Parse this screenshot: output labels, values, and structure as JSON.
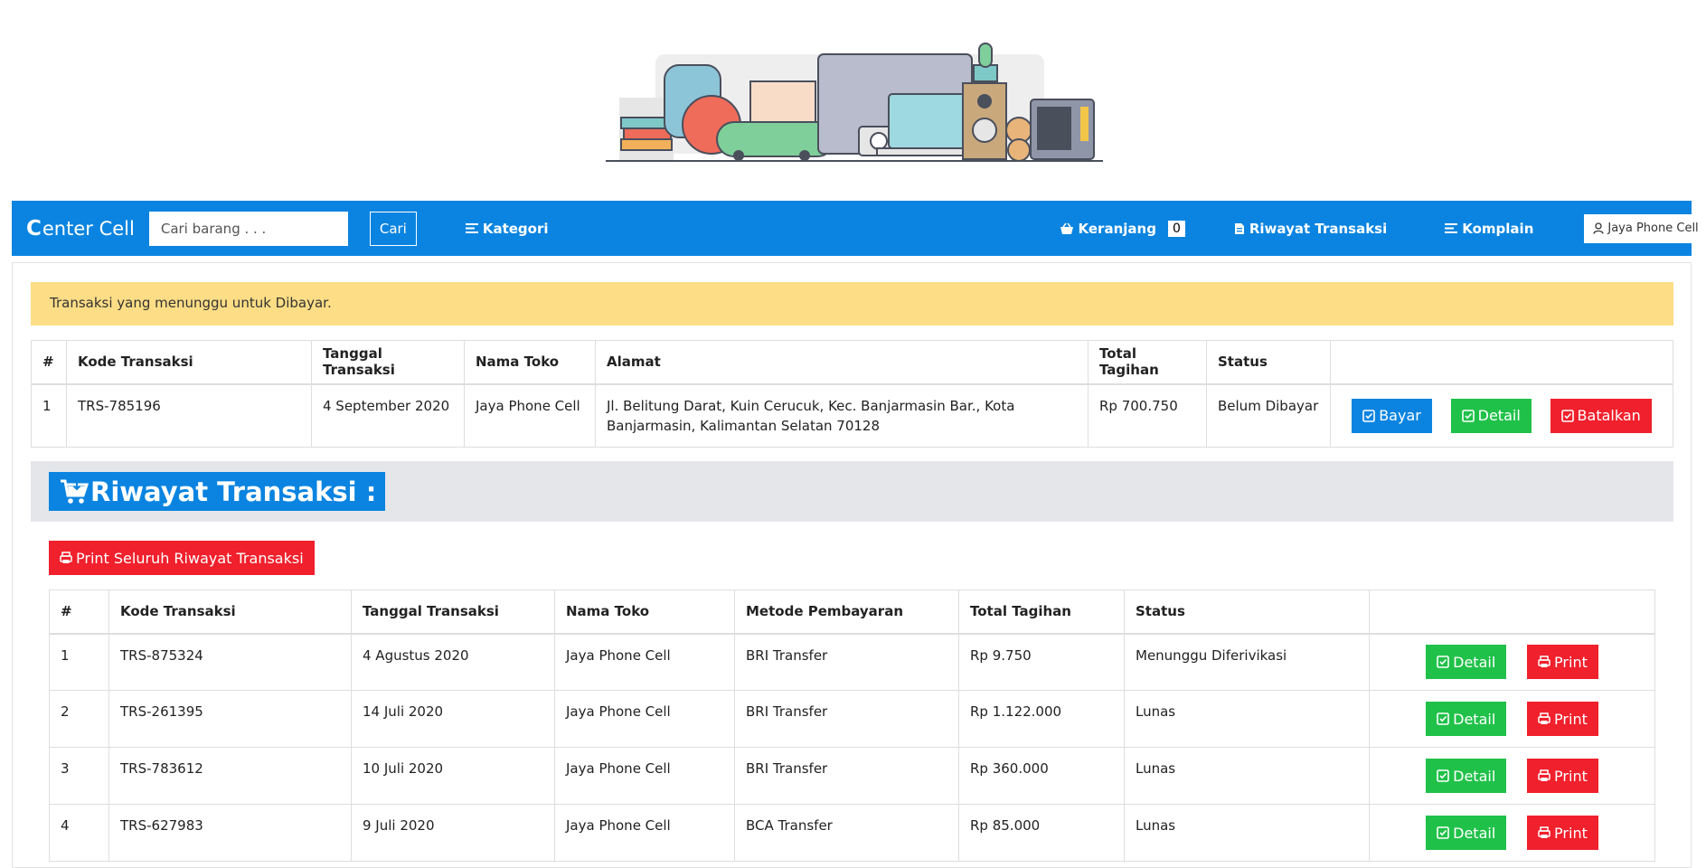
{
  "brand": {
    "logo_letter": "C",
    "rest": "enter Cell"
  },
  "search": {
    "placeholder": "Cari barang . . .",
    "button": "Cari"
  },
  "nav": {
    "kategori": "Kategori",
    "keranjang": "Keranjang",
    "cart_count": "0",
    "riwayat": "Riwayat Transaksi",
    "komplain": "Komplain",
    "user": "Jaya Phone Cell"
  },
  "alert": {
    "text": "Transaksi yang menunggu untuk Dibayar."
  },
  "pending_table": {
    "headers": [
      "#",
      "Kode Transaksi",
      "Tanggal Transaksi",
      "Nama Toko",
      "Alamat",
      "Total Tagihan",
      "Status",
      ""
    ],
    "rows": [
      {
        "no": "1",
        "kode": "TRS-785196",
        "tanggal": "4 September 2020",
        "toko": "Jaya Phone Cell",
        "alamat": "Jl. Belitung Darat, Kuin Cerucuk, Kec. Banjarmasin Bar., Kota Banjarmasin, Kalimantan Selatan 70128",
        "total": "Rp 700.750",
        "status": "Belum Dibayar",
        "btn_bayar": "Bayar",
        "btn_detail": "Detail",
        "btn_batal": "Batalkan"
      }
    ]
  },
  "history": {
    "title": "Riwayat Transaksi :",
    "print_all": "Print Seluruh Riwayat Transaksi",
    "headers": [
      "#",
      "Kode Transaksi",
      "Tanggal Transaksi",
      "Nama Toko",
      "Metode Pembayaran",
      "Total Tagihan",
      "Status",
      ""
    ],
    "rows": [
      {
        "no": "1",
        "kode": "TRS-875324",
        "tanggal": "4 Agustus 2020",
        "toko": "Jaya Phone Cell",
        "metode": "BRI Transfer",
        "total": "Rp 9.750",
        "status": "Menunggu Diferivikasi",
        "btn_detail": "Detail",
        "btn_print": "Print"
      },
      {
        "no": "2",
        "kode": "TRS-261395",
        "tanggal": "14 Juli 2020",
        "toko": "Jaya Phone Cell",
        "metode": "BRI Transfer",
        "total": "Rp 1.122.000",
        "status": "Lunas",
        "btn_detail": "Detail",
        "btn_print": "Print"
      },
      {
        "no": "3",
        "kode": "TRS-783612",
        "tanggal": "10 Juli 2020",
        "toko": "Jaya Phone Cell",
        "metode": "BRI Transfer",
        "total": "Rp 360.000",
        "status": "Lunas",
        "btn_detail": "Detail",
        "btn_print": "Print"
      },
      {
        "no": "4",
        "kode": "TRS-627983",
        "tanggal": "9 Juli 2020",
        "toko": "Jaya Phone Cell",
        "metode": "BCA Transfer",
        "total": "Rp 85.000",
        "status": "Lunas",
        "btn_detail": "Detail",
        "btn_print": "Print"
      }
    ]
  },
  "icons": {
    "cart": "basket-icon",
    "history": "document-icon",
    "menu": "list-icon",
    "user": "user-icon",
    "check": "check-square-icon",
    "print": "printer-icon",
    "cart_title": "shopping-cart-icon"
  },
  "colors": {
    "primary": "#0a84e0",
    "success": "#20c149",
    "danger": "#f0202c",
    "alert_bg": "#fddd85",
    "section_bg": "#e4e6ea"
  }
}
